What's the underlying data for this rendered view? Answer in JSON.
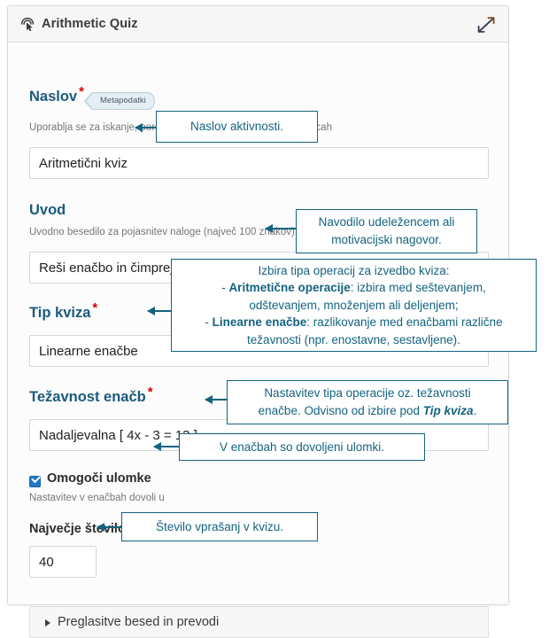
{
  "window": {
    "title": "Arithmetic Quiz",
    "icon": "click-pointer-icon",
    "expand_icon": "expand-diagonal-icon"
  },
  "form": {
    "fields": [
      {
        "label": "Naslov",
        "required": "*",
        "badge": "Metapodatki",
        "description": "Uporablja se za iskanje, poročila in informacije o avtorskih pravicah",
        "value": "Aritmetični kviz",
        "type": "text"
      },
      {
        "label": "Uvod",
        "required": "",
        "description": "Uvodno besedilo za pojasnitev naloge (največ 100 znakov)",
        "value": "Reši enačbo in čimprej izberi odgovor.",
        "type": "text"
      },
      {
        "label": "Tip kviza",
        "required": "*",
        "description": "",
        "value": "Linearne enačbe",
        "type": "select"
      },
      {
        "label": "Težavnost enačb",
        "required": "*",
        "description": "",
        "value": "Nadaljevalna [ 4x - 3 = 13 ]",
        "type": "select"
      },
      {
        "label": "Omogoči ulomke",
        "required": "",
        "description": "Nastavitev v enačbah dovoli u",
        "value": "",
        "checked": true,
        "type": "checkbox"
      },
      {
        "label": "Največje število vprašanj",
        "required": "*",
        "description": "",
        "value": "40",
        "type": "number"
      }
    ],
    "collapsible": {
      "label": "Preglasitve besed in prevodi",
      "caret": "caret-right-icon"
    }
  },
  "annotations": {
    "title_note": "Naslov aktivnosti.",
    "intro_note_line1": "Navodilo udeležencem  ali",
    "intro_note_line2": "motivacijski nagovor.",
    "quiztype_note": {
      "line1": "Izbira tipa operacij za izvedbo kviza:",
      "line2_prefix": "- ",
      "line2_bold": "Aritmetične operacije",
      "line2_rest": ": izbira med seštevanjem,",
      "line3": "odštevanjem, množenjem ali deljenjem;",
      "line4_prefix": "- ",
      "line4_bold": "Linearne enačbe",
      "line4_rest": ": razlikovanje med enačbami različne",
      "line5": "težavnosti (npr. enostavne, sestavljene)."
    },
    "difficulty_note": {
      "line1": "Nastavitev tipa operacije oz. težavnosti",
      "line2_pre": "enačbe. Odvisno od izbire pod ",
      "line2_em": "Tip kviza",
      "line2_post": "."
    },
    "fractions_note": "V enačbah so dovoljeni ulomki.",
    "count_note": "Število vprašanj v kvizu."
  },
  "colors": {
    "accent": "#13637f",
    "heading": "#1c5a7d",
    "required": "#cc0000",
    "checkbox": "#1f78c8"
  }
}
